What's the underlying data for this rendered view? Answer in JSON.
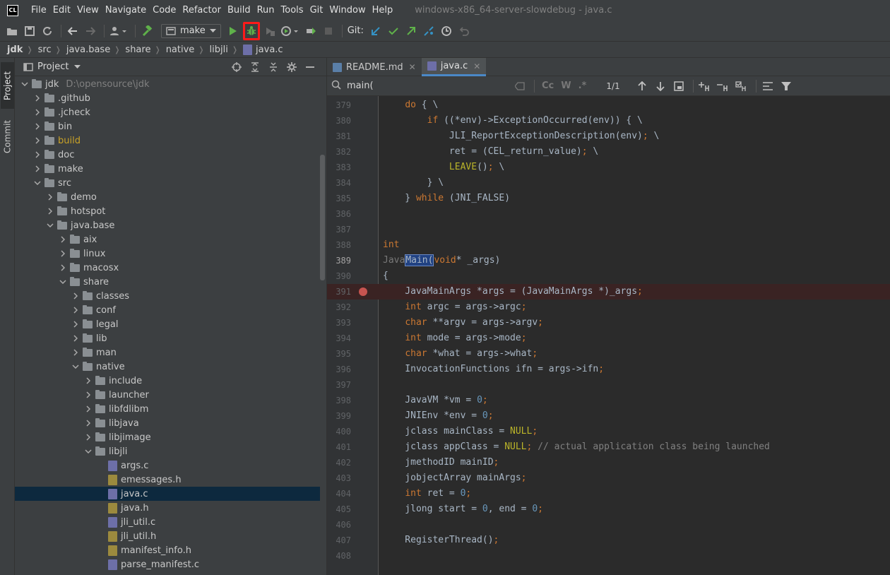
{
  "menubar": {
    "logo": "CL",
    "items": [
      "File",
      "Edit",
      "View",
      "Navigate",
      "Code",
      "Refactor",
      "Build",
      "Run",
      "Tools",
      "Git",
      "Window",
      "Help"
    ],
    "window_title": "windows-x86_64-server-slowdebug - java.c"
  },
  "toolbar": {
    "run_config": "make",
    "git_label": "Git:"
  },
  "breadcrumb": [
    "jdk",
    "src",
    "java.base",
    "share",
    "native",
    "libjli",
    "java.c"
  ],
  "side_tabs": {
    "project": "Project",
    "commit": "Commit"
  },
  "project_panel": {
    "title": "Project"
  },
  "tree": [
    {
      "depth": 0,
      "name": "jdk",
      "type": "folder",
      "open": true,
      "path": "D:\\opensource\\jdk"
    },
    {
      "depth": 1,
      "name": ".github",
      "type": "folder"
    },
    {
      "depth": 1,
      "name": ".jcheck",
      "type": "folder"
    },
    {
      "depth": 1,
      "name": "bin",
      "type": "folder"
    },
    {
      "depth": 1,
      "name": "build",
      "type": "folder",
      "excluded": true
    },
    {
      "depth": 1,
      "name": "doc",
      "type": "folder"
    },
    {
      "depth": 1,
      "name": "make",
      "type": "folder"
    },
    {
      "depth": 1,
      "name": "src",
      "type": "folder",
      "open": true
    },
    {
      "depth": 2,
      "name": "demo",
      "type": "folder"
    },
    {
      "depth": 2,
      "name": "hotspot",
      "type": "folder"
    },
    {
      "depth": 2,
      "name": "java.base",
      "type": "folder",
      "open": true
    },
    {
      "depth": 3,
      "name": "aix",
      "type": "folder"
    },
    {
      "depth": 3,
      "name": "linux",
      "type": "folder"
    },
    {
      "depth": 3,
      "name": "macosx",
      "type": "folder"
    },
    {
      "depth": 3,
      "name": "share",
      "type": "folder",
      "open": true
    },
    {
      "depth": 4,
      "name": "classes",
      "type": "folder"
    },
    {
      "depth": 4,
      "name": "conf",
      "type": "folder"
    },
    {
      "depth": 4,
      "name": "legal",
      "type": "folder"
    },
    {
      "depth": 4,
      "name": "lib",
      "type": "folder"
    },
    {
      "depth": 4,
      "name": "man",
      "type": "folder"
    },
    {
      "depth": 4,
      "name": "native",
      "type": "folder",
      "open": true
    },
    {
      "depth": 5,
      "name": "include",
      "type": "folder"
    },
    {
      "depth": 5,
      "name": "launcher",
      "type": "folder"
    },
    {
      "depth": 5,
      "name": "libfdlibm",
      "type": "folder"
    },
    {
      "depth": 5,
      "name": "libjava",
      "type": "folder"
    },
    {
      "depth": 5,
      "name": "libjimage",
      "type": "folder"
    },
    {
      "depth": 5,
      "name": "libjli",
      "type": "folder",
      "open": true
    },
    {
      "depth": 6,
      "name": "args.c",
      "type": "c"
    },
    {
      "depth": 6,
      "name": "emessages.h",
      "type": "h"
    },
    {
      "depth": 6,
      "name": "java.c",
      "type": "c",
      "selected": true
    },
    {
      "depth": 6,
      "name": "java.h",
      "type": "h"
    },
    {
      "depth": 6,
      "name": "jli_util.c",
      "type": "c"
    },
    {
      "depth": 6,
      "name": "jli_util.h",
      "type": "h"
    },
    {
      "depth": 6,
      "name": "manifest_info.h",
      "type": "h"
    },
    {
      "depth": 6,
      "name": "parse_manifest.c",
      "type": "c"
    }
  ],
  "editor": {
    "tabs": [
      {
        "label": "README.md",
        "active": false
      },
      {
        "label": "java.c",
        "active": true
      }
    ],
    "search": {
      "value": "main(",
      "match_count": "1/1",
      "options": [
        "Cc",
        "W",
        ".*"
      ]
    }
  },
  "code": [
    {
      "n": "379",
      "html": "    <span class='kw'>do</span> { \\"
    },
    {
      "n": "380",
      "html": "        <span class='kw'>if</span> ((*env)->ExceptionOccurred(env)) { \\"
    },
    {
      "n": "381",
      "html": "            JLI_ReportExceptionDescription(env)<span class='kw'>;</span> \\"
    },
    {
      "n": "382",
      "html": "            ret = (CEL_return_value)<span class='kw'>;</span> \\"
    },
    {
      "n": "383",
      "html": "            <span class='mac'>LEAVE</span>()<span class='kw'>;</span> \\"
    },
    {
      "n": "384",
      "html": "        } \\"
    },
    {
      "n": "385",
      "html": "    } <span class='kw'>while</span> (JNI_FALSE)"
    },
    {
      "n": "386",
      "html": ""
    },
    {
      "n": "387",
      "html": ""
    },
    {
      "n": "388",
      "html": "<span class='kw'>int</span>"
    },
    {
      "n": "389",
      "html": "<span class='dim'>Java</span><span class='hl'>Main(</span><span class='kw'>void</span>* _args)",
      "current": true
    },
    {
      "n": "390",
      "html": "{"
    },
    {
      "n": "391",
      "html": "    JavaMainArgs *args = (JavaMainArgs *)_args<span class='kw'>;</span>",
      "breakpoint": true
    },
    {
      "n": "392",
      "html": "    <span class='kw'>int</span> argc = args->argc<span class='kw'>;</span>"
    },
    {
      "n": "393",
      "html": "    <span class='kw'>char</span> **argv = args->argv<span class='kw'>;</span>"
    },
    {
      "n": "394",
      "html": "    <span class='kw'>int</span> mode = args->mode<span class='kw'>;</span>"
    },
    {
      "n": "395",
      "html": "    <span class='kw'>char</span> *what = args->what<span class='kw'>;</span>"
    },
    {
      "n": "396",
      "html": "    InvocationFunctions ifn = args->ifn<span class='kw'>;</span>"
    },
    {
      "n": "397",
      "html": ""
    },
    {
      "n": "398",
      "html": "    JavaVM *vm = <span class='num'>0</span><span class='kw'>;</span>"
    },
    {
      "n": "399",
      "html": "    JNIEnv *env = <span class='num'>0</span><span class='kw'>;</span>"
    },
    {
      "n": "400",
      "html": "    jclass mainClass = <span class='mac'>NULL</span><span class='kw'>;</span>"
    },
    {
      "n": "401",
      "html": "    jclass appClass = <span class='mac'>NULL</span><span class='kw'>;</span> <span class='cmt'>// actual application class being launched</span>"
    },
    {
      "n": "402",
      "html": "    jmethodID mainID<span class='kw'>;</span>"
    },
    {
      "n": "403",
      "html": "    jobjectArray mainArgs<span class='kw'>;</span>"
    },
    {
      "n": "404",
      "html": "    <span class='kw'>int</span> ret = <span class='num'>0</span><span class='kw'>;</span>"
    },
    {
      "n": "405",
      "html": "    jlong start = <span class='num'>0</span>, end = <span class='num'>0</span><span class='kw'>;</span>"
    },
    {
      "n": "406",
      "html": ""
    },
    {
      "n": "407",
      "html": "    RegisterThread()<span class='kw'>;</span>"
    },
    {
      "n": "408",
      "html": ""
    }
  ]
}
